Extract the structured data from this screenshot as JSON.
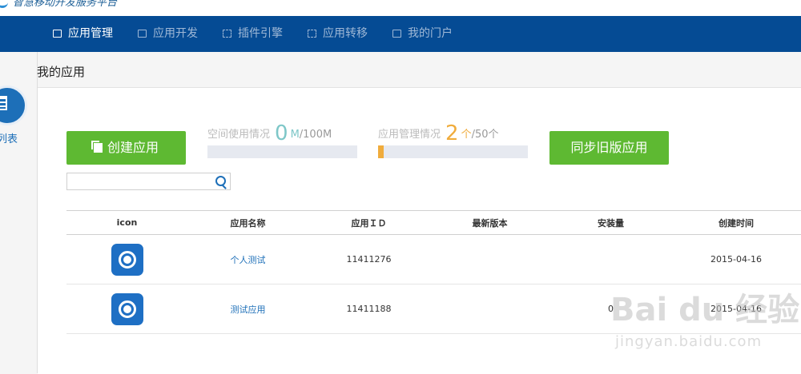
{
  "header": {
    "logo_text": "智慧移动开发服务平台"
  },
  "nav": {
    "items": [
      {
        "label": "应用管理",
        "icon": "app-manage-icon",
        "active": true
      },
      {
        "label": "应用开发",
        "icon": "app-develop-icon",
        "active": false
      },
      {
        "label": "插件引擎",
        "icon": "plugin-engine-icon",
        "active": false
      },
      {
        "label": "应用转移",
        "icon": "app-transfer-icon",
        "active": false
      },
      {
        "label": "我的门户",
        "icon": "portal-icon",
        "active": false
      }
    ]
  },
  "sidebar": {
    "label": "列表",
    "icon": "app-list-icon"
  },
  "page": {
    "title": "我的应用"
  },
  "actions": {
    "create_label": "创建应用",
    "sync_label": "同步旧版应用"
  },
  "stats": {
    "space": {
      "label": "空间使用情况",
      "value": "0",
      "unit": "M",
      "total": "/100M",
      "fraction": 0.0,
      "color": "#7ec7c8"
    },
    "apps": {
      "label": "应用管理情况",
      "value": "2",
      "unit": "个",
      "total": "/50个",
      "fraction": 0.04,
      "color": "#f0ac3c"
    }
  },
  "search": {
    "value": "",
    "placeholder": ""
  },
  "table": {
    "headers": [
      "icon",
      "应用名称",
      "应用ＩＤ",
      "最新版本",
      "安装量",
      "创建时间"
    ],
    "rows": [
      {
        "name": "个人测试",
        "id": "11411276",
        "version": "",
        "installs": "",
        "created": "2015-04-16"
      },
      {
        "name": "测试应用",
        "id": "11411188",
        "version": "",
        "installs": "0",
        "created": "2015-04-16"
      }
    ]
  },
  "watermark": {
    "brand": "Bai du 经验",
    "url": "jingyan.baidu.com"
  },
  "colors": {
    "nav_bg": "#054b94",
    "primary": "#1d6fb8",
    "green": "#5eb932",
    "orange": "#f0ac3c",
    "teal": "#7ec7c8"
  }
}
